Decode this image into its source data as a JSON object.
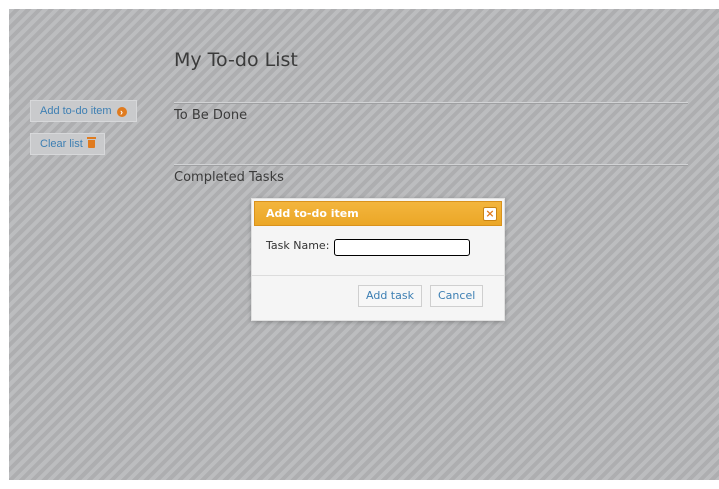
{
  "sidebar": {
    "add_todo_label": "Add to-do item",
    "clear_list_label": "Clear list"
  },
  "main": {
    "title": "My To-do List",
    "sections": [
      {
        "heading": "To Be Done"
      },
      {
        "heading": "Completed Tasks"
      }
    ]
  },
  "dialog": {
    "title": "Add to-do item",
    "close_glyph": "×",
    "task_name_label": "Task Name:",
    "task_name_value": "",
    "add_task_label": "Add task",
    "cancel_label": "Cancel"
  },
  "icons": {
    "add": "plus-circle-icon",
    "clear": "trash-icon",
    "close": "close-icon"
  },
  "colors": {
    "accent": "#eba727",
    "link": "#3d7fb3",
    "icon": "#e07b1f"
  }
}
